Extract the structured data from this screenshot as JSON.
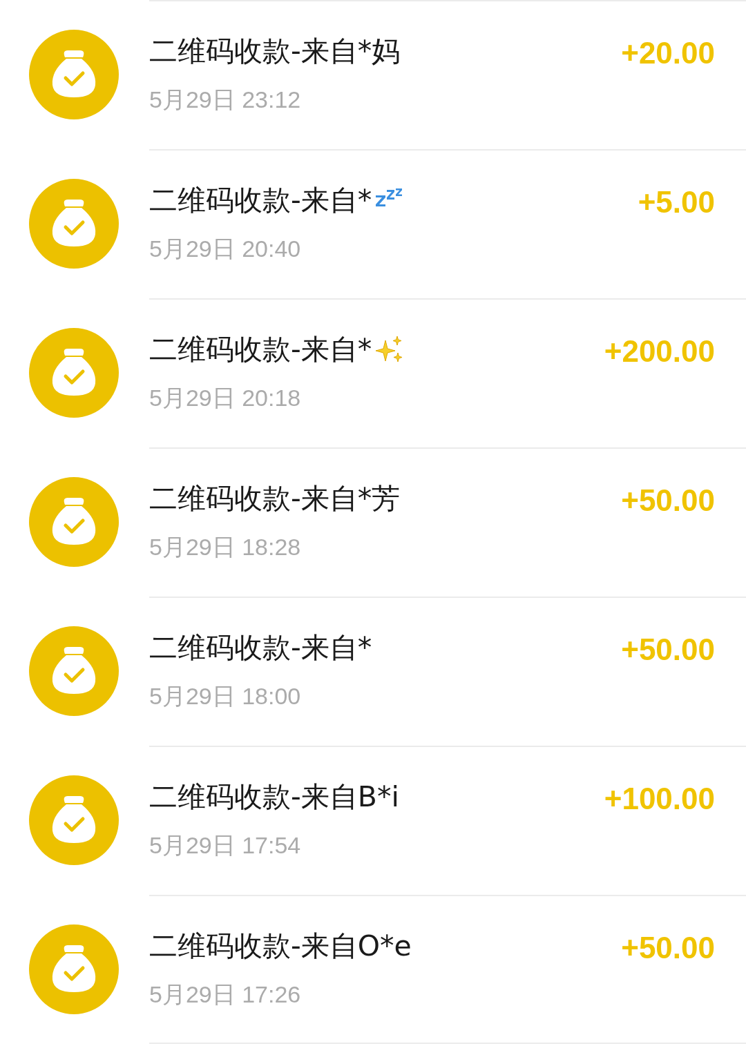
{
  "transactions": [
    {
      "title": "二维码收款-来自*妈",
      "time": "5月29日 23:12",
      "amount": "+20.00"
    },
    {
      "title": "二维码收款-来自*",
      "badge": {
        "kind": "zzz"
      },
      "time": "5月29日 20:40",
      "amount": "+5.00"
    },
    {
      "title": "二维码收款-来自*",
      "badge": {
        "kind": "sparkles"
      },
      "time": "5月29日 20:18",
      "amount": "+200.00"
    },
    {
      "title": "二维码收款-来自*芳",
      "time": "5月29日 18:28",
      "amount": "+50.00"
    },
    {
      "title": "二维码收款-来自*",
      "time": "5月29日 18:00",
      "amount": "+50.00"
    },
    {
      "title": "二维码收款-来自B*i",
      "time": "5月29日 17:54",
      "amount": "+100.00"
    },
    {
      "title": "二维码收款-来自O*e",
      "time": "5月29日 17:26",
      "amount": "+50.00"
    }
  ]
}
